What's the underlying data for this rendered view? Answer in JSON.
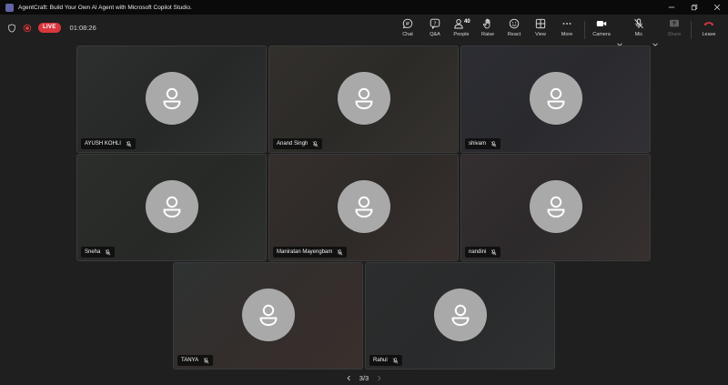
{
  "window": {
    "title": "AgentCraft: Build Your Own AI Agent with Microsoft Copilot Studio.",
    "icons": [
      "teams-logo-icon",
      "minimize-icon",
      "restore-icon",
      "close-icon"
    ]
  },
  "status": {
    "live_label": "LIVE",
    "elapsed": "01:08:26"
  },
  "toolbar": {
    "chat": "Chat",
    "qa": "Q&A",
    "people": "People",
    "people_count": "40",
    "raise": "Raise",
    "react": "React",
    "view": "View",
    "more": "More",
    "camera": "Camera",
    "mic": "Mic",
    "share": "Share",
    "leave": "Leave"
  },
  "colors": {
    "live": "#d9363e",
    "leave": "#d9363e",
    "avatar": "#a9a9a9",
    "background": "#1f1f1f"
  },
  "participants": [
    {
      "name": "AYUSH KOHLI"
    },
    {
      "name": "Anand Singh"
    },
    {
      "name": "shivam"
    },
    {
      "name": "Sneha"
    },
    {
      "name": "Maniratan Mayengbam"
    },
    {
      "name": "nandini"
    },
    {
      "name": "TANYA"
    },
    {
      "name": "Rahul"
    }
  ],
  "pagination": {
    "label": "3/3"
  }
}
